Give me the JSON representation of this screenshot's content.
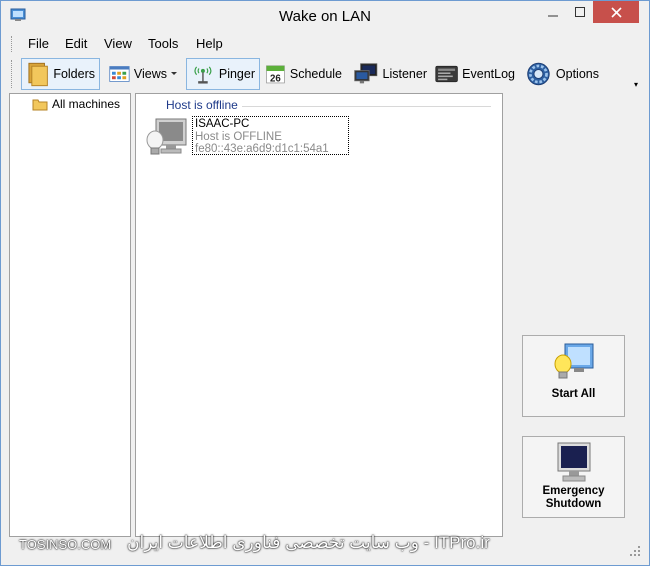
{
  "window": {
    "title": "Wake on LAN"
  },
  "menu": {
    "items": [
      "File",
      "Edit",
      "View",
      "Tools",
      "Help"
    ]
  },
  "toolbar": {
    "folders": "Folders",
    "views": "Views",
    "pinger": "Pinger",
    "schedule": "Schedule",
    "schedule_day": "26",
    "listener": "Listener",
    "eventlog": "EventLog",
    "options": "Options"
  },
  "tree": {
    "root": "All machines"
  },
  "main": {
    "group_header": "Host is offline",
    "machine": {
      "name": "ISAAC-PC",
      "status": "Host is OFFLINE",
      "address": "fe80::43e:a6d9:d1c1:54a1"
    }
  },
  "side_buttons": {
    "start_all": "Start All",
    "shutdown_line1": "Emergency",
    "shutdown_line2": "Shutdown"
  },
  "watermark": {
    "left": "TOSINSO.COM",
    "right": "ITPro.ir - وب سایت تخصصی فناوری اطلاعات ایران"
  },
  "colors": {
    "close_button": "#c7504b",
    "group_header": "#1e3a8a",
    "offline_text": "#8a8a8a"
  }
}
